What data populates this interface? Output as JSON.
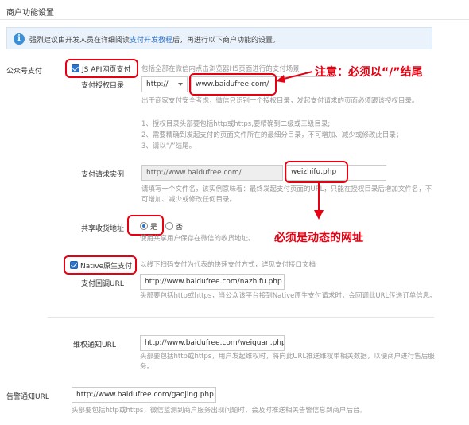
{
  "section_title": "商户功能设置",
  "notice": {
    "prefix": "强烈建议由开发人员在详细阅读",
    "link": "支付开发教程",
    "suffix": "后，再进行以下商户功能的设置。"
  },
  "gzh": {
    "label": "公众号支付",
    "jsapi_label": "JS API网页支付",
    "jsapi_desc": "包括全部在微信内点击浏览器H5页面进行的支付场景",
    "dir_label": "支付授权目录",
    "protocol": "http://",
    "dir_value": "www.baidufree.com/",
    "dir_help_1": "出于商家支付安全考虑，微信只识别一个授权目录，发起支付请求的页面必须跟该授权目录。",
    "dir_help_2": "1、授权目录头部要包括http或https,要精确到二级或三级目录;",
    "dir_help_3": "2、需要精确到发起支付的页面文件所在的最细分目录，不可增加、减少或修改此目录；",
    "dir_help_4": "3、请以“/”结尾。",
    "req_label": "支付请求实例",
    "req_prefix": "http://www.baidufree.com/",
    "req_file": "weizhifu.php",
    "req_help": "请填写一个文件名，该实例意味着：最终发起支付页面的URL，只能在授权目录后增加文件名，不可增加、减少或修改任何目录。",
    "share_label": "共享收货地址",
    "share_yes": "是",
    "share_no": "否",
    "share_help": "使用共享用户保存在微信的收货地址。"
  },
  "native": {
    "label": "Native原生支付",
    "desc": "以线下扫码支付为代表的快速支付方式，详见支付接口文档",
    "cb_label": "支付回调URL",
    "cb_value": "http://www.baidufree.com/nazhifu.php",
    "cb_help": "头部要包括http或https，当公众该平台接到Native原生支付请求时，会回调此URL传递订单信息。"
  },
  "rights": {
    "label": "维权通知URL",
    "value": "http://www.baidufree.com/weiquan.php",
    "help": "头部要包括http或https，用户发起维权时，将向此URL推送维权单相关数据，以便商户进行售后服务。"
  },
  "alarm": {
    "label": "告警通知URL",
    "value": "http://www.baidufree.com/gaojing.php",
    "help": "头部要包括http或https，微信监测到商户服务出现问题时，会及时推送相关告警信息到商户后台。"
  },
  "annotations": {
    "slash_note": "注意：必须以“/”结尾",
    "dynamic_note": "必须是动态的网址"
  },
  "colors": {
    "annotation_red": "#e60012",
    "accent_blue": "#2d73c7"
  }
}
